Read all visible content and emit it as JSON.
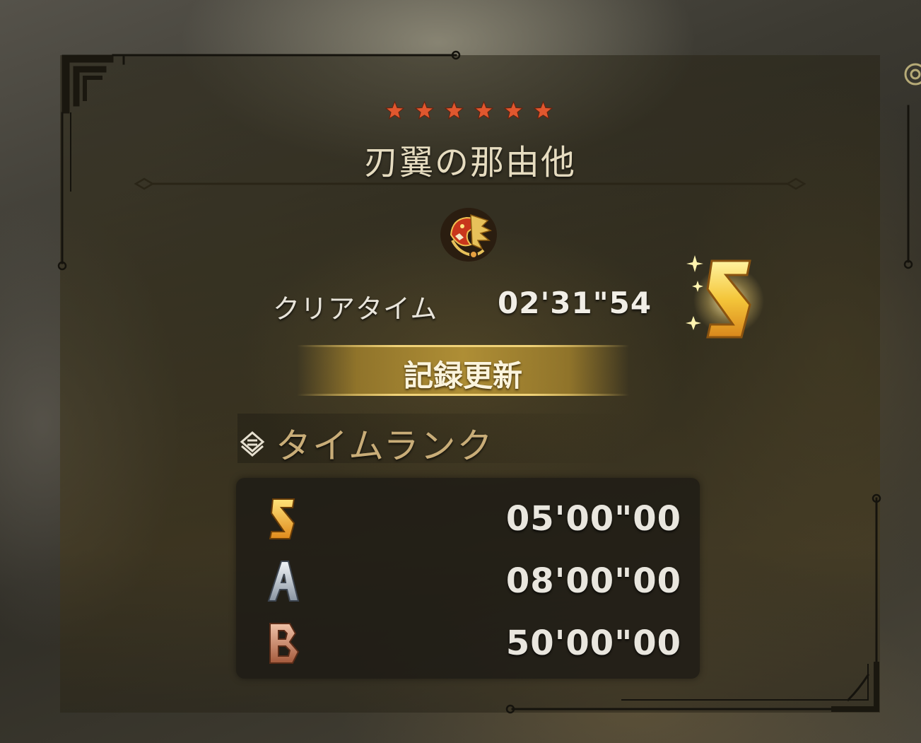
{
  "quest": {
    "difficulty_stars": 6,
    "title": "刃翼の那由他",
    "monster_icon": "dragon-head-icon"
  },
  "clear": {
    "label": "クリアタイム",
    "time": "02'31\"54",
    "rank": "S"
  },
  "record_banner": {
    "label": "記録更新"
  },
  "time_rank": {
    "title": "タイムランク",
    "icon": "diamond-chain-icon",
    "rows": [
      {
        "rank": "S",
        "time": "05'00\"00"
      },
      {
        "rank": "A",
        "time": "08'00\"00"
      },
      {
        "rank": "B",
        "time": "50'00\"00"
      }
    ]
  },
  "colors": {
    "star": "#e0572e",
    "gold": "#e3b33a",
    "rank_a": "#b7bfc8",
    "rank_b": "#c98a6a",
    "section_title": "#c9ad78"
  }
}
